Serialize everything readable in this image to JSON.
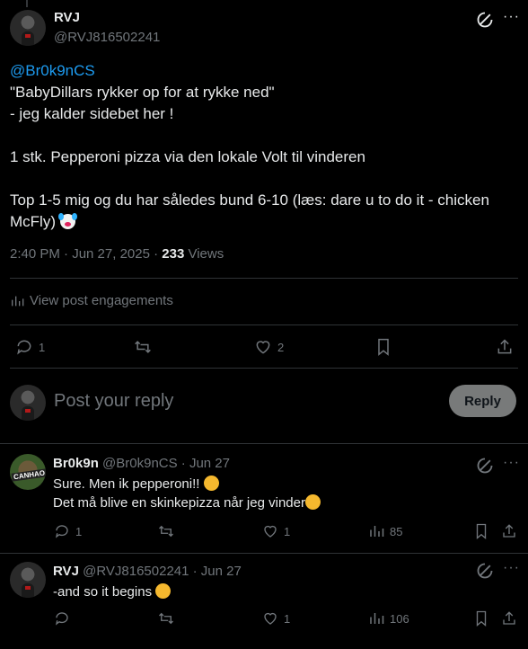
{
  "main_post": {
    "author": "RVJ",
    "handle": "@RVJ816502241",
    "mention": "@Br0k9nCS",
    "text": "\"BabyDillars rykker op for at rykke ned\"\n- jeg kalder sidebet her !\n\n1 stk. Pepperoni pizza via den lokale Volt til vinderen\n\nTop 1-5 mig og du har således bund 6-10 (læs: dare u to do it - chicken McFly)",
    "time": "2:40 PM · Jun 27, 2025 · ",
    "views_count": "233",
    "views_label": " Views",
    "engagements_label": "View post engagements",
    "reply_count": "1",
    "repost_count": "",
    "like_count": "2"
  },
  "composer": {
    "placeholder": "Post your reply",
    "button_label": "Reply"
  },
  "replies": [
    {
      "author": "Br0k9n",
      "handle": "@Br0k9nCS",
      "date": " · Jun 27",
      "avatar_text": "CANHAO",
      "line1": "Sure. Men ik pepperoni!! ",
      "line2": "Det må blive en skinkepizza når jeg vinder",
      "reply_count": "1",
      "like_count": "1",
      "views": "85"
    },
    {
      "author": "RVJ",
      "handle": "@RVJ816502241",
      "date": " · Jun 27",
      "line1": "-and so it begins ",
      "reply_count": "",
      "like_count": "1",
      "views": "106"
    }
  ],
  "colors": {
    "background": "#000000",
    "text": "#e7e9ea",
    "muted": "#71767b",
    "link": "#1d9bf0",
    "divider": "#2f3336"
  },
  "icons": [
    "grok-icon",
    "more-icon",
    "reply-icon",
    "repost-icon",
    "like-icon",
    "bookmark-icon",
    "share-icon",
    "analytics-icon"
  ]
}
